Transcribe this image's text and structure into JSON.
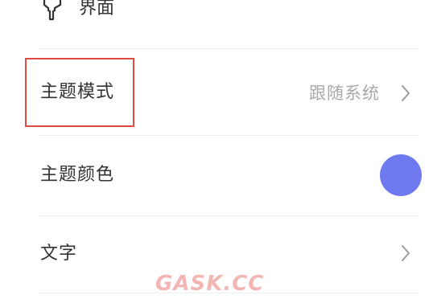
{
  "section": {
    "title": "界面",
    "icon": "brush-icon"
  },
  "rows": [
    {
      "label": "主题模式",
      "value": "跟随系统"
    },
    {
      "label": "主题颜色",
      "color": "#6f7af0"
    },
    {
      "label": "文字"
    }
  ],
  "watermark": "GASK.CC",
  "accent": {
    "highlight_border": "#e04a3f",
    "theme_color": "#6f7af0"
  }
}
